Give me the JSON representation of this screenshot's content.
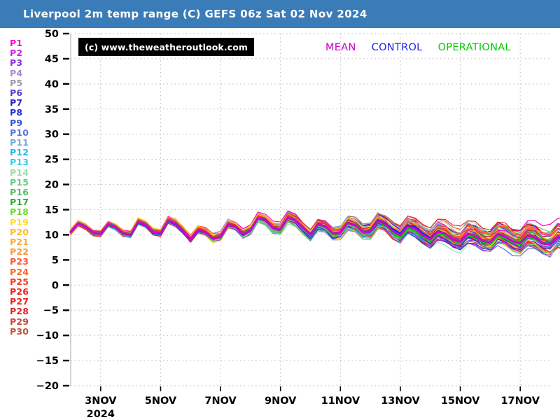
{
  "header": {
    "title": "Liverpool 2m temp range (C) GEFS 06z Sat 02 Nov 2024",
    "background_color": "#3a7cb8",
    "text_color": "#ffffff"
  },
  "copyright": {
    "text": "(c) www.theweatheroutlook.com",
    "background_color": "#000000",
    "text_color": "#ffffff"
  },
  "special_legend": [
    {
      "label": "MEAN",
      "color": "#cc00cc"
    },
    {
      "label": "CONTROL",
      "color": "#2222ee"
    },
    {
      "label": "OPERATIONAL",
      "color": "#00cc00"
    }
  ],
  "ensemble_legend": [
    {
      "label": "P1",
      "color": "#ff00cc"
    },
    {
      "label": "P2",
      "color": "#cc22dd"
    },
    {
      "label": "P3",
      "color": "#8833dd"
    },
    {
      "label": "P4",
      "color": "#aa88cc"
    },
    {
      "label": "P5",
      "color": "#9999aa"
    },
    {
      "label": "P6",
      "color": "#5544cc"
    },
    {
      "label": "P7",
      "color": "#3322bb"
    },
    {
      "label": "P8",
      "color": "#2233cc"
    },
    {
      "label": "P9",
      "color": "#3355cc"
    },
    {
      "label": "P10",
      "color": "#5577dd"
    },
    {
      "label": "P11",
      "color": "#77aadd"
    },
    {
      "label": "P12",
      "color": "#22bbee"
    },
    {
      "label": "P13",
      "color": "#33ccee"
    },
    {
      "label": "P14",
      "color": "#99ddaa"
    },
    {
      "label": "P15",
      "color": "#66cc88"
    },
    {
      "label": "P16",
      "color": "#55bb66"
    },
    {
      "label": "P17",
      "color": "#33aa33"
    },
    {
      "label": "P18",
      "color": "#66dd22"
    },
    {
      "label": "P19",
      "color": "#ffdd22"
    },
    {
      "label": "P20",
      "color": "#ffbb22"
    },
    {
      "label": "P21",
      "color": "#ffaa33"
    },
    {
      "label": "P22",
      "color": "#ff9933"
    },
    {
      "label": "P23",
      "color": "#ff5533"
    },
    {
      "label": "P24",
      "color": "#ff6622"
    },
    {
      "label": "P25",
      "color": "#ff3322"
    },
    {
      "label": "P26",
      "color": "#ee2222"
    },
    {
      "label": "P27",
      "color": "#ee2211"
    },
    {
      "label": "P28",
      "color": "#dd2222"
    },
    {
      "label": "P29",
      "color": "#cc4433"
    },
    {
      "label": "P30",
      "color": "#bb5544"
    }
  ],
  "chart_data": {
    "type": "line",
    "title": "Liverpool 2m temp range (C) GEFS 06z Sat 02 Nov 2024",
    "xlabel": "",
    "ylabel": "",
    "grid": true,
    "legend_position": "left",
    "ylim": [
      -20,
      50
    ],
    "yticks": [
      50,
      45,
      40,
      35,
      30,
      25,
      20,
      15,
      10,
      5,
      0,
      -5,
      -10,
      -15,
      -20
    ],
    "xlim": [
      0,
      16
    ],
    "xticks": [
      1,
      3,
      5,
      7,
      9,
      11,
      13,
      15
    ],
    "xticklabels": [
      "3NOV",
      "5NOV",
      "7NOV",
      "9NOV",
      "11NOV",
      "13NOV",
      "15NOV",
      "17NOV"
    ],
    "x_year_label": "2024",
    "x_unit_days": 1,
    "samples_per_day": 4,
    "n_members": 30,
    "description": "GEFS ensemble spaghetti plot of 2m temperature for Liverpool. 30 perturbation members plus mean, control and operational runs. Values hold near 10-13C for the first week with a diurnal sawtooth, then trend down to 7-10C with widening spread after 13NOV.",
    "baseline": {
      "comment": "Mean-of-ensemble daily cycle anchor values in degrees C, sampled every 6 hours from 3NOV 00z to 18NOV 00z.",
      "values": [
        10.6,
        12.3,
        11.6,
        10.4,
        10.2,
        12.1,
        11.5,
        10.3,
        10.0,
        12.6,
        12.0,
        10.6,
        10.4,
        12.9,
        12.3,
        10.8,
        9.0,
        11.0,
        10.6,
        9.3,
        9.6,
        12.0,
        11.6,
        10.2,
        11.0,
        13.4,
        12.9,
        11.4,
        11.2,
        13.6,
        13.0,
        11.5,
        10.2,
        12.2,
        11.8,
        10.4,
        10.6,
        12.5,
        12.0,
        10.7,
        10.8,
        12.8,
        12.2,
        10.8,
        10.0,
        11.8,
        11.3,
        10.0,
        9.2,
        10.8,
        10.4,
        9.2,
        8.8,
        10.4,
        10.0,
        8.9,
        8.6,
        10.2,
        9.8,
        8.7,
        8.4,
        10.0,
        9.6,
        8.5,
        8.2,
        9.8,
        9.4,
        8.3,
        8.0,
        9.6,
        9.2,
        8.1,
        7.9,
        9.5,
        9.1,
        8.0,
        7.8,
        9.4,
        9.0,
        7.9
      ]
    },
    "spread": {
      "comment": "Standard deviation of the ensemble in degrees C at each 6-hour step; grows with forecast lead time.",
      "start": 0.45,
      "end": 2.6
    },
    "series": [
      {
        "name": "MEAN",
        "color": "#cc00cc",
        "width": 3.0,
        "role": "mean"
      },
      {
        "name": "CONTROL",
        "color": "#2222ee",
        "width": 3.0,
        "role": "control"
      },
      {
        "name": "OPERATIONAL",
        "color": "#00cc00",
        "width": 3.4,
        "role": "operational"
      }
    ]
  }
}
